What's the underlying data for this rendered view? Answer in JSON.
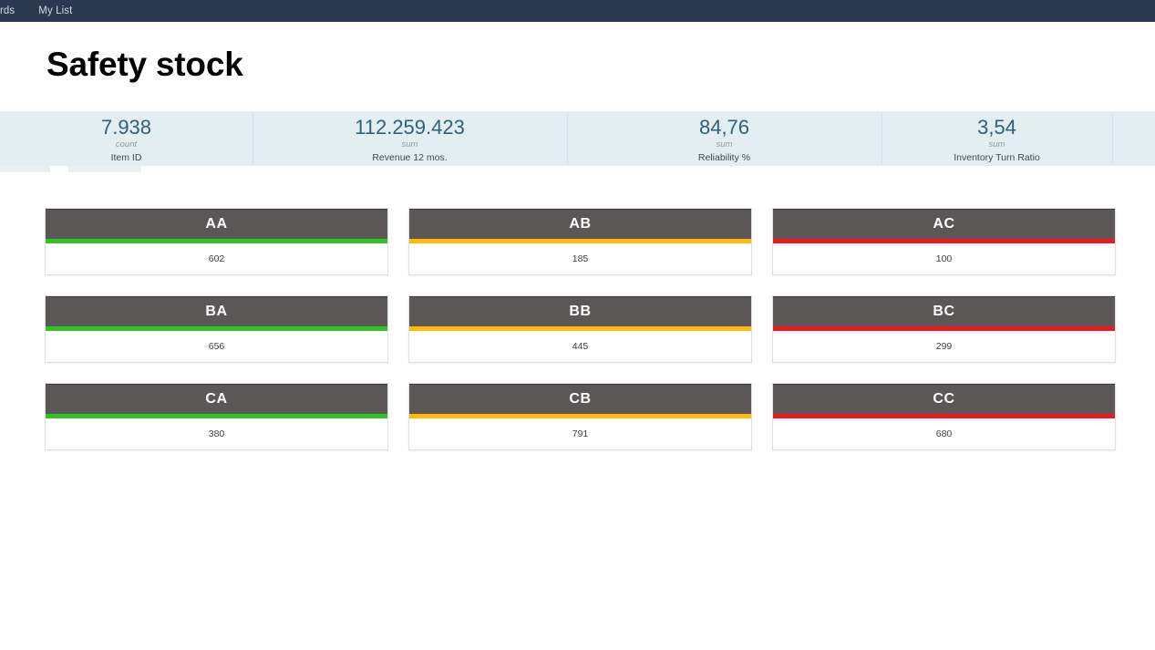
{
  "topnav": {
    "background": "#2b3950",
    "items": [
      {
        "label": "hboards"
      },
      {
        "label": "My List"
      }
    ]
  },
  "header": {
    "title": "Safety stock"
  },
  "kpis": {
    "background": "#e3eef3",
    "value_color": "#2f6077",
    "items": [
      {
        "value": "7.938",
        "agg": "count",
        "label": "Item ID"
      },
      {
        "value": "112.259.423",
        "agg": "sum",
        "label": "Revenue 12 mos."
      },
      {
        "value": "84,76",
        "agg": "sum",
        "label": "Reliability %"
      },
      {
        "value": "3,54",
        "agg": "sum",
        "label": "Inventory Turn Ratio"
      }
    ]
  },
  "colors": {
    "green": "#2ec426",
    "amber": "#ffbd08",
    "red": "#ef1717",
    "card_header": "#5b5757"
  },
  "cards": [
    {
      "title": "AA",
      "value": "602",
      "status": "green",
      "bar_color": "#2ec426"
    },
    {
      "title": "AB",
      "value": "185",
      "status": "amber",
      "bar_color": "#ffbd08"
    },
    {
      "title": "AC",
      "value": "100",
      "status": "red",
      "bar_color": "#ef1717"
    },
    {
      "title": "BA",
      "value": "656",
      "status": "green",
      "bar_color": "#2ec426"
    },
    {
      "title": "BB",
      "value": "445",
      "status": "amber",
      "bar_color": "#ffbd08"
    },
    {
      "title": "BC",
      "value": "299",
      "status": "red",
      "bar_color": "#ef1717"
    },
    {
      "title": "CA",
      "value": "380",
      "status": "green",
      "bar_color": "#2ec426"
    },
    {
      "title": "CB",
      "value": "791",
      "status": "amber",
      "bar_color": "#ffbd08"
    },
    {
      "title": "CC",
      "value": "680",
      "status": "red",
      "bar_color": "#ef1717"
    }
  ]
}
